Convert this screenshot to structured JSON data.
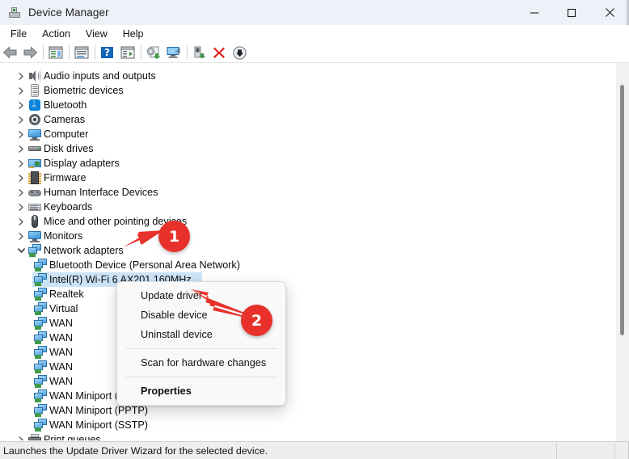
{
  "window": {
    "title": "Device Manager",
    "icon": "device-manager-icon",
    "controls": {
      "minimize": "minimize-icon",
      "maximize": "maximize-icon",
      "close": "close-icon"
    }
  },
  "menubar": {
    "items": [
      {
        "label": "File"
      },
      {
        "label": "Action"
      },
      {
        "label": "View"
      },
      {
        "label": "Help"
      }
    ]
  },
  "toolbar": {
    "buttons": [
      {
        "name": "back-button",
        "icon": "back-arrow-icon"
      },
      {
        "name": "forward-button",
        "icon": "forward-arrow-icon"
      },
      {
        "name": "separator-1",
        "icon": "separator"
      },
      {
        "name": "show-hide-console-tree-button",
        "icon": "console-tree-icon"
      },
      {
        "name": "separator-2",
        "icon": "separator"
      },
      {
        "name": "properties-button",
        "icon": "properties-window-icon"
      },
      {
        "name": "separator-3",
        "icon": "separator"
      },
      {
        "name": "help-button",
        "icon": "help-question-icon"
      },
      {
        "name": "show-hide-action-pane-button",
        "icon": "action-pane-icon"
      },
      {
        "name": "separator-4",
        "icon": "separator"
      },
      {
        "name": "update-driver-button",
        "icon": "update-driver-icon"
      },
      {
        "name": "scan-for-hardware-changes-button",
        "icon": "scan-hardware-icon"
      },
      {
        "name": "separator-5",
        "icon": "separator"
      },
      {
        "name": "enable-device-button",
        "icon": "enable-device-icon"
      },
      {
        "name": "uninstall-device-button",
        "icon": "red-x-icon"
      },
      {
        "name": "disable-device-button",
        "icon": "down-arrow-circle-icon"
      }
    ]
  },
  "tree": {
    "rows": [
      {
        "label": "Audio inputs and outputs",
        "icon": "speaker-icon",
        "indent": 0,
        "state": "collapsed",
        "selected": false
      },
      {
        "label": "Biometric devices",
        "icon": "fingerprint-icon",
        "indent": 0,
        "state": "collapsed",
        "selected": false
      },
      {
        "label": "Bluetooth",
        "icon": "bluetooth-icon",
        "indent": 0,
        "state": "collapsed",
        "selected": false
      },
      {
        "label": "Cameras",
        "icon": "camera-icon",
        "indent": 0,
        "state": "collapsed",
        "selected": false
      },
      {
        "label": "Computer",
        "icon": "monitor-icon",
        "indent": 0,
        "state": "collapsed",
        "selected": false
      },
      {
        "label": "Disk drives",
        "icon": "disk-drive-icon",
        "indent": 0,
        "state": "collapsed",
        "selected": false
      },
      {
        "label": "Display adapters",
        "icon": "display-adapter-icon",
        "indent": 0,
        "state": "collapsed",
        "selected": false
      },
      {
        "label": "Firmware",
        "icon": "chip-icon",
        "indent": 0,
        "state": "collapsed",
        "selected": false
      },
      {
        "label": "Human Interface Devices",
        "icon": "gamepad-icon",
        "indent": 0,
        "state": "collapsed",
        "selected": false
      },
      {
        "label": "Keyboards",
        "icon": "keyboard-icon",
        "indent": 0,
        "state": "collapsed",
        "selected": false
      },
      {
        "label": "Mice and other pointing devices",
        "icon": "mouse-icon",
        "indent": 0,
        "state": "collapsed",
        "selected": false
      },
      {
        "label": "Monitors",
        "icon": "monitor-icon",
        "indent": 0,
        "state": "collapsed",
        "selected": false
      },
      {
        "label": "Network adapters",
        "icon": "network-adapter-icon",
        "indent": 0,
        "state": "expanded",
        "selected": false
      },
      {
        "label": "Bluetooth Device (Personal Area Network)",
        "icon": "network-adapter-icon",
        "indent": 1,
        "state": "leaf",
        "selected": false
      },
      {
        "label": "Intel(R) Wi-Fi 6 AX201 160MHz",
        "icon": "network-adapter-icon",
        "indent": 1,
        "state": "leaf",
        "selected": true
      },
      {
        "label": "Realtek",
        "icon": "network-adapter-icon",
        "indent": 1,
        "state": "leaf",
        "selected": false
      },
      {
        "label": "Virtual",
        "icon": "network-adapter-icon",
        "indent": 1,
        "state": "leaf",
        "selected": false
      },
      {
        "label": "WAN",
        "icon": "network-adapter-icon",
        "indent": 1,
        "state": "leaf",
        "selected": false
      },
      {
        "label": "WAN",
        "icon": "network-adapter-icon",
        "indent": 1,
        "state": "leaf",
        "selected": false
      },
      {
        "label": "WAN",
        "icon": "network-adapter-icon",
        "indent": 1,
        "state": "leaf",
        "selected": false
      },
      {
        "label": "WAN",
        "icon": "network-adapter-icon",
        "indent": 1,
        "state": "leaf",
        "selected": false
      },
      {
        "label": "WAN",
        "icon": "network-adapter-icon",
        "indent": 1,
        "state": "leaf",
        "selected": false
      },
      {
        "label": "WAN Miniport (PPPOE)",
        "icon": "network-adapter-icon",
        "indent": 1,
        "state": "leaf",
        "selected": false
      },
      {
        "label": "WAN Miniport (PPTP)",
        "icon": "network-adapter-icon",
        "indent": 1,
        "state": "leaf",
        "selected": false
      },
      {
        "label": "WAN Miniport (SSTP)",
        "icon": "network-adapter-icon",
        "indent": 1,
        "state": "leaf",
        "selected": false
      },
      {
        "label": "Print queues",
        "icon": "printer-icon",
        "indent": 0,
        "state": "collapsed",
        "selected": false
      }
    ]
  },
  "context_menu": {
    "items": [
      {
        "label": "Update driver",
        "type": "item"
      },
      {
        "label": "Disable device",
        "type": "item"
      },
      {
        "label": "Uninstall device",
        "type": "item"
      },
      {
        "label": "",
        "type": "separator"
      },
      {
        "label": "Scan for hardware changes",
        "type": "item"
      },
      {
        "label": "",
        "type": "separator"
      },
      {
        "label": "Properties",
        "type": "item-bold"
      }
    ]
  },
  "annotations": {
    "accent_color": "#e8312a",
    "markers": [
      {
        "number": "1",
        "target": "network-adapters-row"
      },
      {
        "number": "2",
        "target": "update-driver-menu-item"
      }
    ]
  },
  "statusbar": {
    "message": "Launches the Update Driver Wizard for the selected device."
  },
  "colors": {
    "titlebar_bg": "#eef1f8",
    "selection_bg": "#cce4f7",
    "menu_bg": "#f9f9f9",
    "status_bg": "#eeeeee",
    "accent_red": "#e8312a"
  }
}
